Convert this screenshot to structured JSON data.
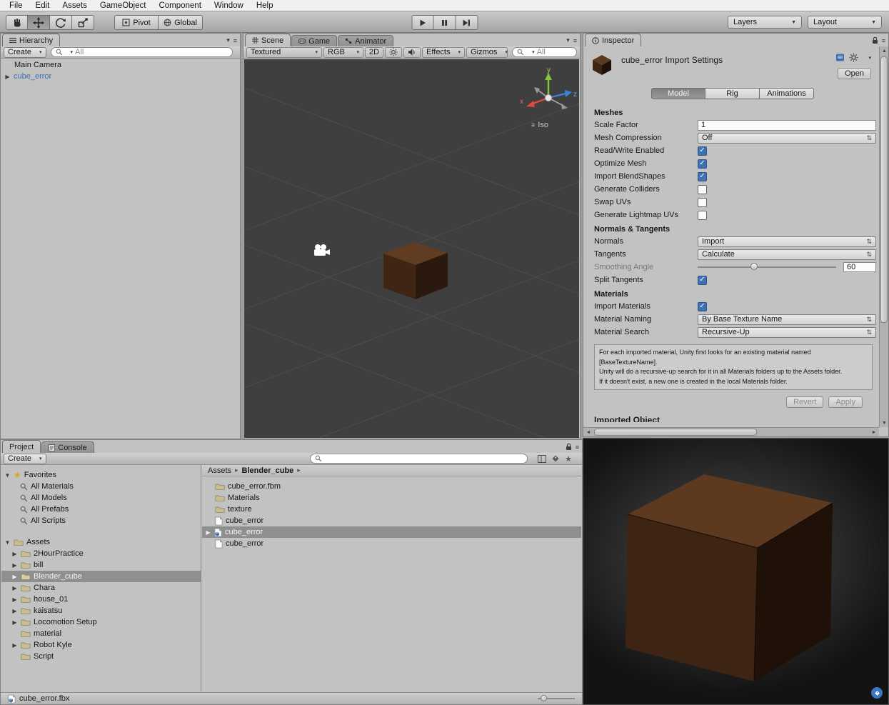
{
  "menu": [
    "File",
    "Edit",
    "Assets",
    "GameObject",
    "Component",
    "Window",
    "Help"
  ],
  "toolbar": {
    "pivot": "Pivot",
    "global": "Global",
    "layers": "Layers",
    "layout": "Layout"
  },
  "hierarchy": {
    "tab": "Hierarchy",
    "create": "Create",
    "search": "All",
    "camera": "Main Camera",
    "cube": "cube_error",
    "prefab_color": "#3e6fb5"
  },
  "scene": {
    "tab": "Scene",
    "tab_game": "Game",
    "tab_animator": "Animator",
    "shading": "Textured",
    "channels": "RGB",
    "two_d": "2D",
    "effects": "Effects",
    "gizmos": "Gizmos",
    "search": "All",
    "iso": "Iso",
    "ax": "x",
    "ay": "y",
    "az": "z",
    "cube": {
      "top": "#5f3c22",
      "front": "#3f2514",
      "right": "#2b190d"
    }
  },
  "inspector": {
    "tab": "Inspector",
    "title": "cube_error Import Settings",
    "open": "Open",
    "tabs": {
      "model": "Model",
      "rig": "Rig",
      "anim": "Animations"
    },
    "meshes": {
      "h": "Meshes",
      "scale_l": "Scale Factor",
      "scale_v": "1",
      "comp_l": "Mesh Compression",
      "comp_v": "Off",
      "rw_l": "Read/Write Enabled",
      "opt_l": "Optimize Mesh",
      "blend_l": "Import BlendShapes",
      "col_l": "Generate Colliders",
      "swap_l": "Swap UVs",
      "lm_l": "Generate Lightmap UVs"
    },
    "nt": {
      "h": "Normals & Tangents",
      "normals_l": "Normals",
      "normals_v": "Import",
      "tangents_l": "Tangents",
      "tangents_v": "Calculate",
      "smooth_l": "Smoothing Angle",
      "smooth_v": "60",
      "split_l": "Split Tangents"
    },
    "mat": {
      "h": "Materials",
      "import_l": "Import Materials",
      "naming_l": "Material Naming",
      "naming_v": "By Base Texture Name",
      "search_l": "Material Search",
      "search_v": "Recursive-Up"
    },
    "help": "For each imported material, Unity first looks for an existing material named [BaseTextureName].\nUnity will do a recursive-up search for it in all Materials folders up to the Assets folder.\nIf it doesn't exist, a new one is created in the local Materials folder.",
    "revert": "Revert",
    "apply": "Apply",
    "clipped": "Imported Object"
  },
  "project": {
    "tab": "Project",
    "tab_console": "Console",
    "create": "Create",
    "fav": "Favorites",
    "fav_items": [
      "All Materials",
      "All Models",
      "All Prefabs",
      "All Scripts"
    ],
    "assets": "Assets",
    "folders": [
      "2HourPractice",
      "bill",
      "Blender_cube",
      "Chara",
      "house_01",
      "kaisatsu",
      "Locomotion Setup",
      "material",
      "Robot Kyle",
      "Script"
    ],
    "selected_folder": "Blender_cube",
    "crumb_root": "Assets",
    "crumb_cur": "Blender_cube",
    "files": [
      "cube_error.fbm",
      "Materials",
      "texture",
      "cube_error",
      "cube_error",
      "cube_error"
    ],
    "selected_file_index": 4,
    "footer": "cube_error.fbx"
  },
  "preview": {
    "cube": {
      "top": "#5d3a1f",
      "front": "#3e2513",
      "right": "#1f1008"
    }
  }
}
